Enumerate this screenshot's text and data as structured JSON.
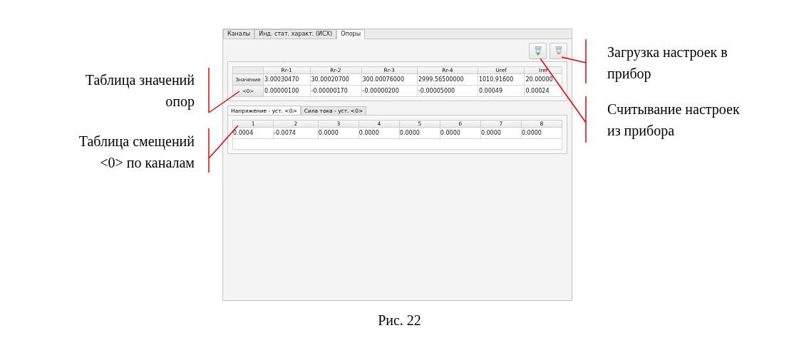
{
  "app": {
    "tabs": [
      {
        "label": "Каналы",
        "selected": false
      },
      {
        "label": "Инд. стат. характ. (ИСХ)",
        "selected": false
      },
      {
        "label": "Опоры",
        "selected": true
      }
    ],
    "toolbar": [
      {
        "kind": "download"
      },
      {
        "kind": "upload"
      }
    ],
    "references_table": {
      "columns": [
        "Rr-1",
        "Rr-2",
        "Rr-3",
        "Rr-4",
        "Uref",
        "Iref"
      ],
      "rows": [
        {
          "header": "Значение",
          "cells": [
            "3.00030470",
            "30.00020700",
            "300.00076000",
            "2999.56500000",
            "1010.91600",
            "20.00000"
          ]
        },
        {
          "header": "<0>",
          "cells": [
            "0.00000100",
            "-0.00000170",
            "-0.00000200",
            "-0.00005000",
            "0.00049",
            "0.00024"
          ]
        }
      ]
    },
    "sub_tabs": [
      {
        "label": "Напряжение - уст. <0>",
        "selected": true
      },
      {
        "label": "Сила тока - уст. <0>",
        "selected": false
      }
    ],
    "offsets_table": {
      "columns": [
        "1",
        "2",
        "3",
        "4",
        "5",
        "6",
        "7",
        "8"
      ],
      "rows": [
        [
          "0.0004",
          "-0.0074",
          "0.0000",
          "0.0000",
          "0.0000",
          "0.0000",
          "0.0000",
          "0.0000"
        ]
      ]
    }
  },
  "annotations": [
    {
      "lines": [
        "Таблица  значений",
        "опор"
      ]
    },
    {
      "lines": [
        "Таблица смещений",
        "<0> по каналам"
      ]
    },
    {
      "lines": [
        "Загрузка настроек в",
        "прибор"
      ]
    },
    {
      "lines": [
        "Считывание настроек",
        "из прибора"
      ]
    }
  ],
  "caption": "Рис. 22"
}
